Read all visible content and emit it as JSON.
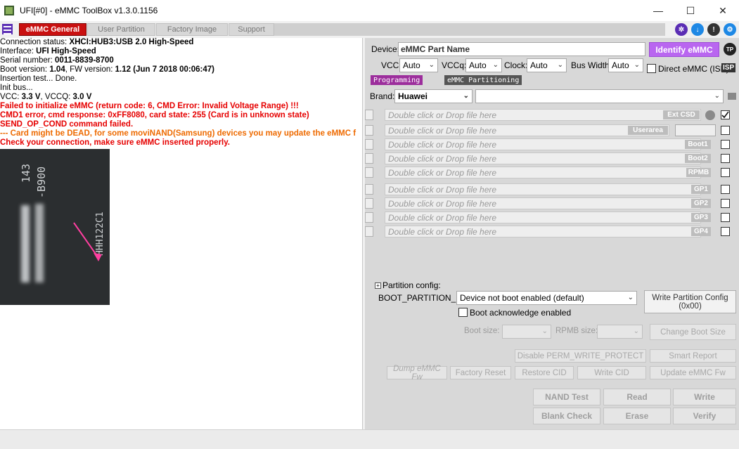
{
  "window": {
    "title": "UFI[#0] - eMMC ToolBox v1.3.0.1156",
    "controls": [
      "—",
      "☐",
      "✕"
    ]
  },
  "tabs": [
    {
      "label": "eMMC General",
      "active": true
    },
    {
      "label": "User Partition",
      "active": false
    },
    {
      "label": "Factory Image",
      "active": false
    },
    {
      "label": "Support",
      "active": false
    }
  ],
  "top_icons": [
    {
      "name": "network-icon",
      "color": "#5a2db4"
    },
    {
      "name": "download-icon",
      "color": "#1e88e5"
    },
    {
      "name": "info-icon",
      "color": "#333333"
    },
    {
      "name": "settings-icon",
      "color": "#1e88e5"
    }
  ],
  "log": {
    "lines": [
      {
        "prefix": "Connection status: ",
        "value": "XHCI:HUB3:USB 2.0 High-Speed",
        "suffix": "",
        "style": "normal"
      },
      {
        "prefix": "Interface: ",
        "value": "UFI High-Speed",
        "suffix": "",
        "style": "normal"
      },
      {
        "prefix": "Serial number: ",
        "value": "0011-8839-8700",
        "suffix": "",
        "style": "normal"
      },
      {
        "prefix": " Boot version: ",
        "value": "1.04",
        "suffix": ", FW version: ",
        "value2": "1.12 (Jun  7 2018 00:06:47)",
        "style": "normal"
      },
      {
        "prefix": "Insertion test... Done.",
        "value": "",
        "suffix": "",
        "style": "normal"
      },
      {
        "prefix": "Init bus...",
        "value": "",
        "suffix": "",
        "style": "normal"
      },
      {
        "prefix": "VCC: ",
        "value": "3.3 V",
        "suffix": ", VCCQ: ",
        "value2": "3.0 V",
        "style": "normal"
      },
      {
        "prefix": "Failed to initialize eMMC (return code: 6, CMD Error: Invalid Voltage Range) !!!",
        "value": "",
        "suffix": "",
        "style": "red"
      },
      {
        "prefix": " CMD1 error, cmd response: 0xFF8080, card state: 255 (Card is in unknown state)",
        "value": "",
        "suffix": "",
        "style": "red"
      },
      {
        "prefix": " SEND_OP_COND command failed.",
        "value": "",
        "suffix": "",
        "style": "red"
      },
      {
        "prefix": "--- Card might be DEAD, for some moviNAND(Samsung) devices you may update the eMMC f",
        "value": "",
        "suffix": "",
        "style": "orange"
      },
      {
        "prefix": "Check your connection, make sure eMMC inserted properly.",
        "value": "",
        "suffix": "",
        "style": "red"
      }
    ],
    "chip_text": {
      "line1": "143",
      "line2": "-B900",
      "line3": "HHH122C1"
    }
  },
  "device": {
    "label": "Device:",
    "part_name": "eMMC Part Name",
    "identify_label": "Identify eMMC",
    "tp_label": "TP"
  },
  "voltage": {
    "vcc_label": "VCC:",
    "vcc_value": "Auto",
    "vccq_label": "VCCq:",
    "vccq_value": "Auto",
    "clock_label": "Clock:",
    "clock_value": "Auto",
    "buswidth_label": "Bus Width:",
    "buswidth_value": "Auto",
    "direct_label": "Direct eMMC (ISP)",
    "isp_label": "ISP"
  },
  "subtabs": [
    {
      "label": "Programming",
      "active": true
    },
    {
      "label": "eMMC Partitioning",
      "active": false
    }
  ],
  "brand": {
    "label": "Brand:",
    "value": "Huawei",
    "model_value": ""
  },
  "files": [
    {
      "placeholder": "Double click or Drop file here",
      "tag": "Ext CSD",
      "checked": true
    },
    {
      "placeholder": "Double click or Drop file here",
      "tag": "Userarea",
      "checked": false
    },
    {
      "placeholder": "Double click or Drop file here",
      "tag": "Boot1",
      "checked": false
    },
    {
      "placeholder": "Double click or Drop file here",
      "tag": "Boot2",
      "checked": false
    },
    {
      "placeholder": "Double click or Drop file here",
      "tag": "RPMB",
      "checked": false
    },
    {
      "placeholder": "Double click or Drop file here",
      "tag": "GP1",
      "checked": false
    },
    {
      "placeholder": "Double click or Drop file here",
      "tag": "GP2",
      "checked": false
    },
    {
      "placeholder": "Double click or Drop file here",
      "tag": "GP3",
      "checked": false
    },
    {
      "placeholder": "Double click or Drop file here",
      "tag": "GP4",
      "checked": false
    }
  ],
  "partition": {
    "title": "Partition config:",
    "boot_partition_label": "BOOT_PARTITION_EN",
    "boot_partition_value": "Device not boot enabled (default)",
    "write_config_label": "Write Partition Config (0x00)",
    "boot_ack_label": "Boot acknowledge enabled",
    "boot_size_label": "Boot size:",
    "rpmb_size_label": "RPMB size:",
    "change_boot_label": "Change Boot Size"
  },
  "actions": {
    "disable_perm": "Disable PERM_WRITE_PROTECT",
    "smart_report": "Smart Report",
    "dump_fw": "Dump eMMC Fw",
    "factory_reset": "Factory Reset",
    "restore_cid": "Restore CID",
    "write_cid": "Write CID",
    "update_fw": "Update eMMC Fw",
    "nand_test": "NAND Test",
    "read": "Read",
    "write": "Write",
    "blank_check": "Blank Check",
    "erase": "Erase",
    "verify": "Verify"
  }
}
